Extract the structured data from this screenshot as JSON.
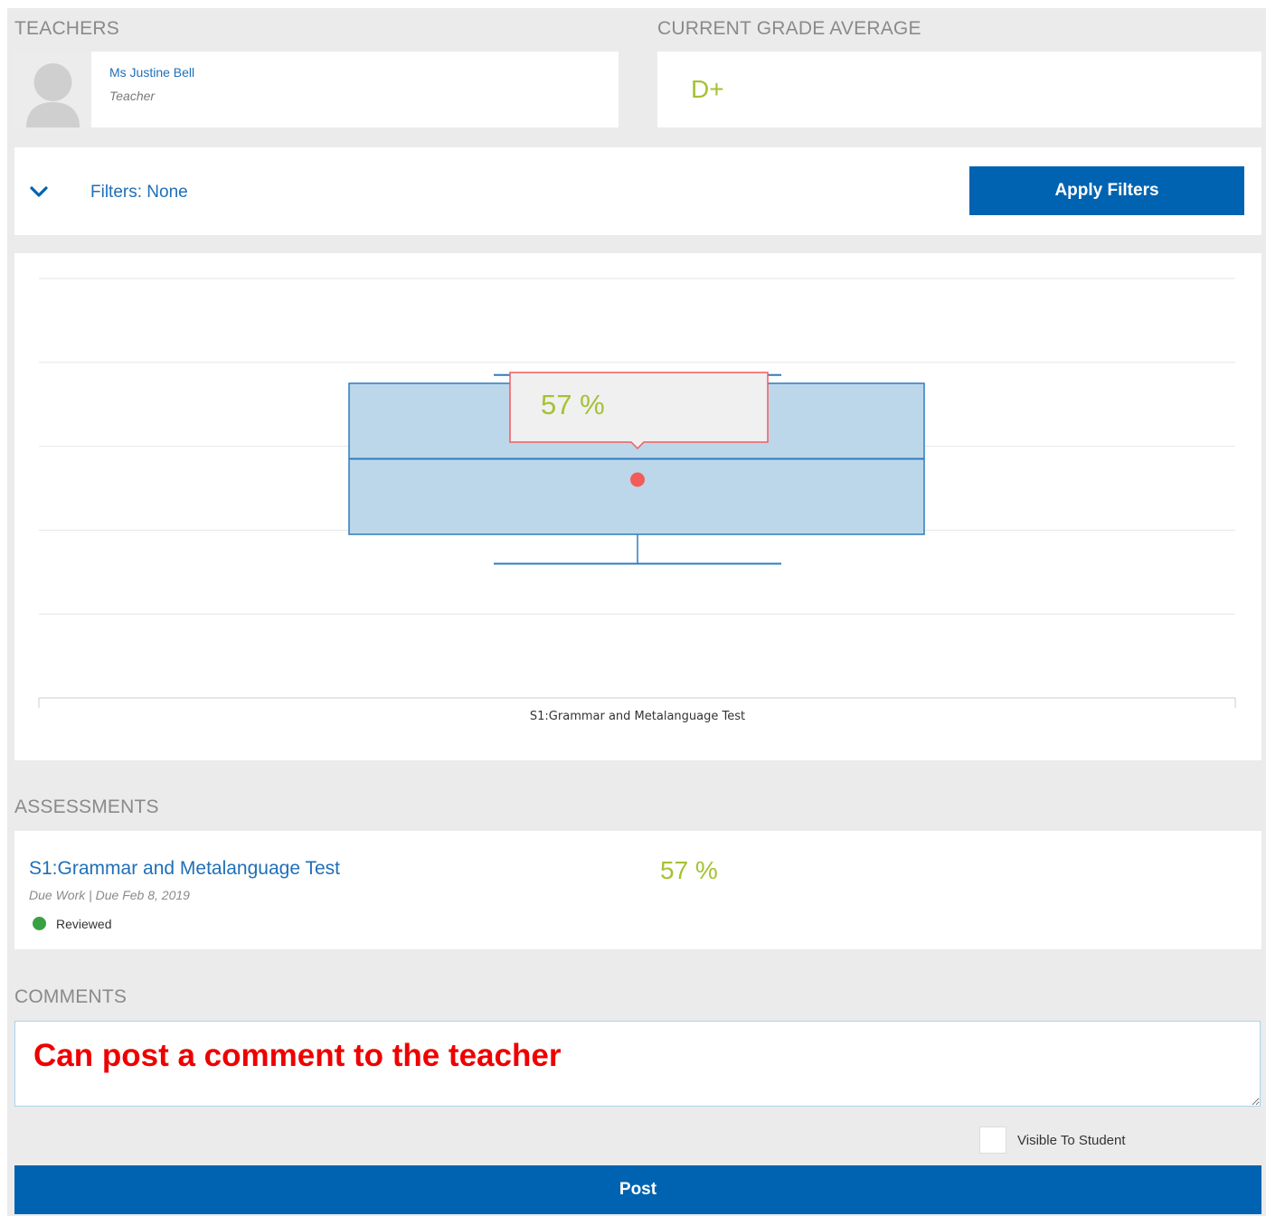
{
  "teachers": {
    "section_title": "TEACHERS",
    "items": [
      {
        "name": "Ms Justine Bell",
        "role": "Teacher"
      }
    ]
  },
  "grade_average": {
    "section_title": "CURRENT GRADE AVERAGE",
    "value": "D+"
  },
  "filters": {
    "label": "Filters: None",
    "apply_label": "Apply Filters"
  },
  "chart_data": {
    "type": "boxplot",
    "categories": [
      "S1:Grammar and Metalanguage Test"
    ],
    "box": {
      "upper_whisker": 77,
      "q3": 75,
      "median": 57,
      "q1": 39,
      "lower_whisker": 32
    },
    "value": 57,
    "value_label": "57 %",
    "ylim": [
      0,
      100
    ],
    "grid": true
  },
  "assessments": {
    "section_title": "ASSESSMENTS",
    "items": [
      {
        "title": "S1:Grammar and Metalanguage Test",
        "meta": "Due Work | Due Feb 8, 2019",
        "status": "Reviewed",
        "score": "57 %"
      }
    ]
  },
  "comments": {
    "section_title": "COMMENTS",
    "comment_value": "Can post a comment to the teacher",
    "visible_label": "Visible To Student",
    "post_label": "Post"
  },
  "colors": {
    "accent": "#0063b1",
    "link": "#1f6fb8",
    "grade": "#a4c232",
    "status_reviewed": "#3aa142",
    "box_fill": "#bdd7ea",
    "box_stroke": "#2d7dc0",
    "marker": "#f45b5b"
  }
}
